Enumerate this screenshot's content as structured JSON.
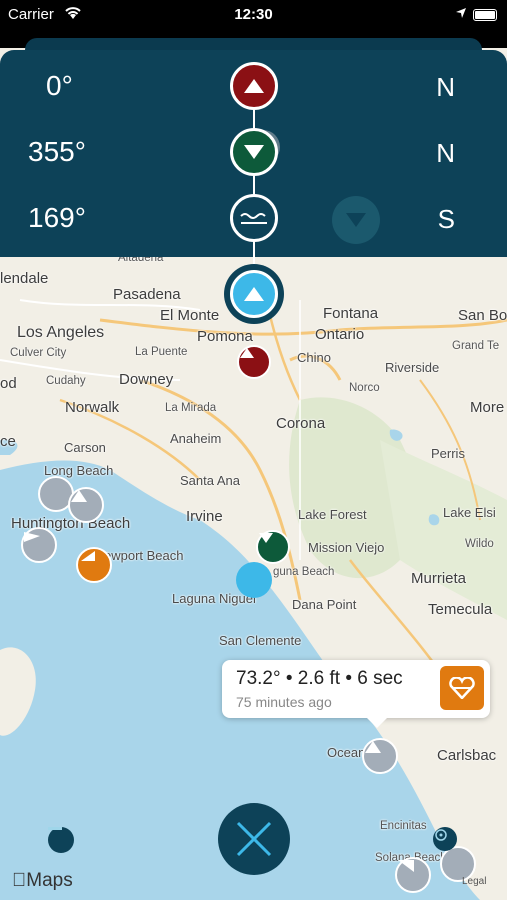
{
  "status_bar": {
    "carrier": "Carrier",
    "time": "12:30"
  },
  "swell_rows": [
    {
      "degrees": "0°",
      "direction": "N",
      "color": "#8b1014"
    },
    {
      "degrees": "355°",
      "direction": "N",
      "color": "#0d5a3a"
    },
    {
      "degrees": "169°",
      "direction": "S",
      "color": "#0d4258"
    }
  ],
  "map_labels": [
    "lendale",
    "Altadena",
    "Pasadena",
    "El Monte",
    "Fontana",
    "San Bo",
    "Los Angeles",
    "Pomona",
    "Ontario",
    "Culver City",
    "La Puente",
    "Chino",
    "Grand Te",
    "od",
    "Cudahy",
    "Downey",
    "Norco",
    "Riverside",
    "Norwalk",
    "La Mirada",
    "More",
    "Carson",
    "Anaheim",
    "Corona",
    "ce",
    "Long Beach",
    "Perris",
    "Santa Ana",
    "Huntington Beach",
    "Irvine",
    "Lake Forest",
    "Lake Elsi",
    "ewport Beach",
    "Mission Viejo",
    "Wildo",
    "guna Beach",
    "Murrieta",
    "Laguna Niguel",
    "Dana Point",
    "Temecula",
    "San Clemente",
    "Oceanside",
    "Carlsbac",
    "Encinitas",
    "Solana Beach"
  ],
  "callout": {
    "main": "73.2° • 2.6 ft • 6 sec",
    "sub": "75 minutes ago",
    "accent": "#e07a10"
  },
  "footer": {
    "maps_label": "Maps",
    "legal_label": "Legal"
  },
  "icons": {
    "close": "close-x-icon",
    "wifi": "wifi-icon",
    "location": "location-arrow-icon",
    "battery": "battery-icon"
  }
}
